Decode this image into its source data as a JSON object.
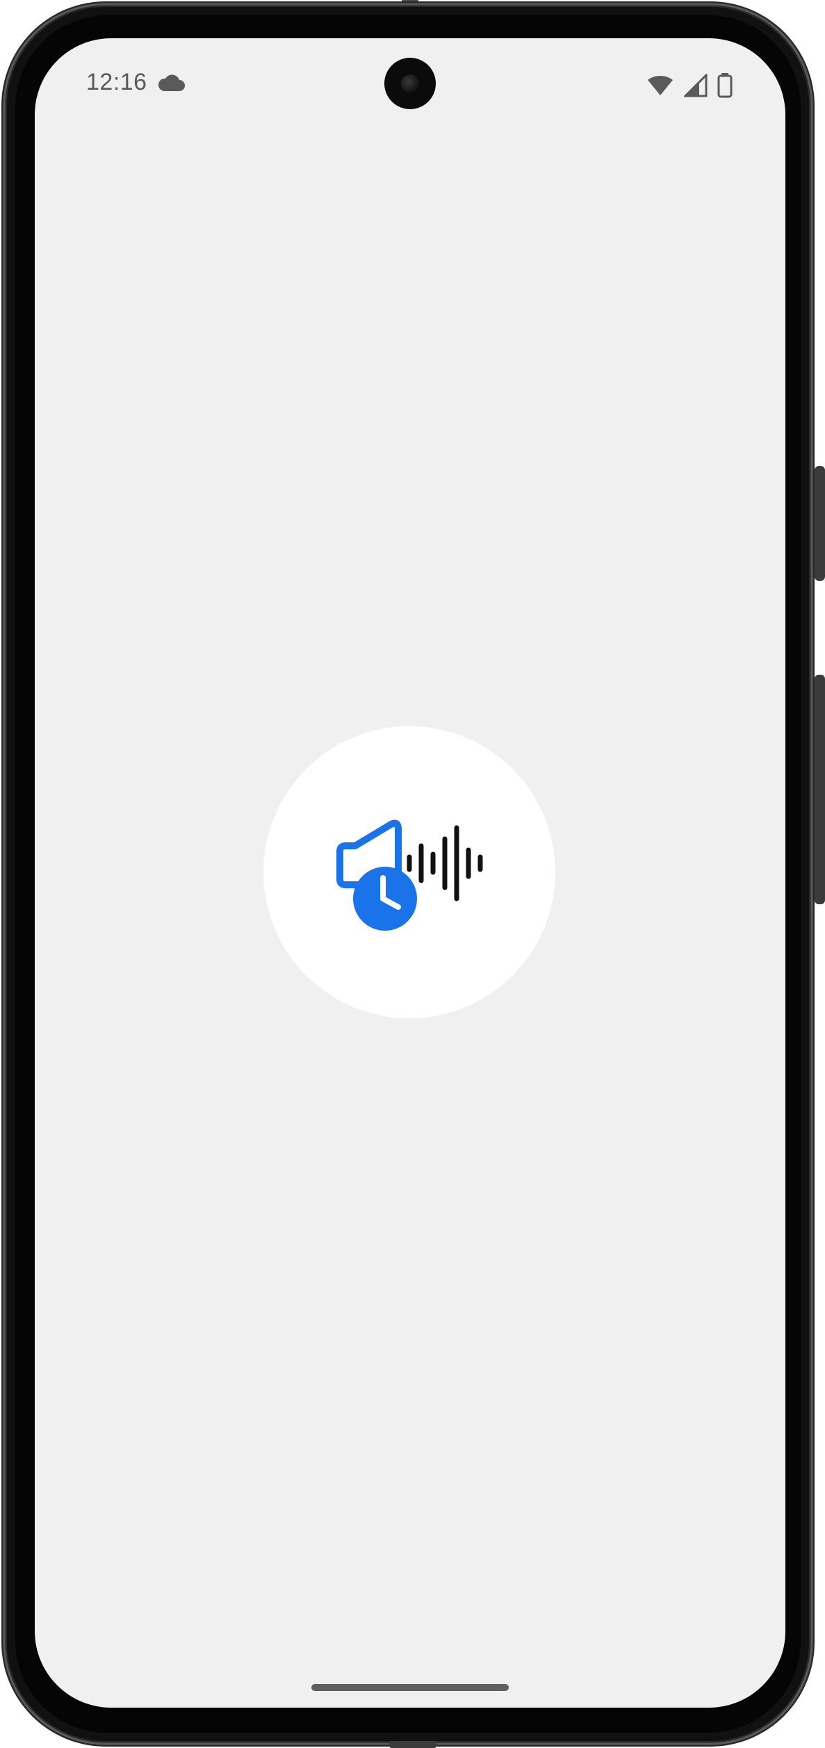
{
  "status_bar": {
    "time": "12:16",
    "notification_icon": "cloud-icon",
    "right_icons": [
      "wifi-icon",
      "cellular-signal-icon",
      "battery-icon"
    ]
  },
  "splash": {
    "logo_icon": "speaker-clock-waveform-icon",
    "logo_colors": {
      "accent": "#1a73e8",
      "waveform": "#111111"
    },
    "background_color": "#f0f0f0",
    "circle_color": "#ffffff"
  },
  "navigation": {
    "home_indicator": "gesture-bar"
  }
}
